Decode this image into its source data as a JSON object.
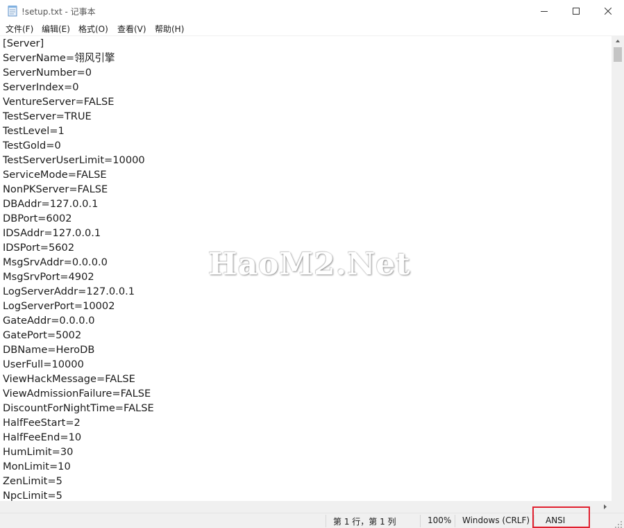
{
  "window": {
    "title": "!setup.txt - 记事本",
    "icon": "notepad-icon"
  },
  "menu": [
    {
      "label": "文件(F)"
    },
    {
      "label": "编辑(E)"
    },
    {
      "label": "格式(O)"
    },
    {
      "label": "查看(V)"
    },
    {
      "label": "帮助(H)"
    }
  ],
  "content": {
    "lines": [
      "[Server]",
      "ServerName=翎风引擎",
      "ServerNumber=0",
      "ServerIndex=0",
      "VentureServer=FALSE",
      "TestServer=TRUE",
      "TestLevel=1",
      "TestGold=0",
      "TestServerUserLimit=10000",
      "ServiceMode=FALSE",
      "NonPKServer=FALSE",
      "DBAddr=127.0.0.1",
      "DBPort=6002",
      "IDSAddr=127.0.0.1",
      "IDSPort=5602",
      "MsgSrvAddr=0.0.0.0",
      "MsgSrvPort=4902",
      "LogServerAddr=127.0.0.1",
      "LogServerPort=10002",
      "GateAddr=0.0.0.0",
      "GatePort=5002",
      "DBName=HeroDB",
      "UserFull=10000",
      "ViewHackMessage=FALSE",
      "ViewAdmissionFailure=FALSE",
      "DiscountForNightTime=FALSE",
      "HalfFeeStart=2",
      "HalfFeeEnd=10",
      "HumLimit=30",
      "MonLimit=10",
      "ZenLimit=5",
      "NpcLimit=5"
    ]
  },
  "status": {
    "position": "第 1 行，第 1 列",
    "zoom": "100%",
    "line_ending": "Windows (CRLF)",
    "encoding": "ANSI",
    "highlight_color": "#e0202f"
  },
  "watermark": "HaoM2.Net"
}
